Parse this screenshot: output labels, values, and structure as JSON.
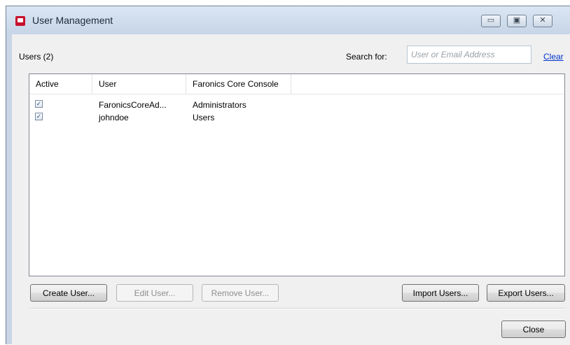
{
  "window": {
    "title": "User Management",
    "controls": {
      "minimize": "▭",
      "maximize": "▣",
      "close": "✕"
    }
  },
  "header": {
    "users_count": "Users (2)",
    "search_label": "Search for:",
    "search_placeholder": "User or Email Address",
    "search_value": "",
    "clear_label": "Clear"
  },
  "table": {
    "columns": [
      "Active",
      "User",
      "Faronics Core Console"
    ],
    "rows": [
      {
        "active": true,
        "user": "FaronicsCoreAd...",
        "console": "Administrators"
      },
      {
        "active": true,
        "user": "johndoe",
        "console": "Users"
      }
    ]
  },
  "buttons": {
    "create_user": "Create User...",
    "edit_user": "Edit User...",
    "remove_user": "Remove User...",
    "import_users": "Import Users...",
    "export_users": "Export Users...",
    "close": "Close"
  },
  "colors": {
    "window_frame": "#c9d6e6",
    "link": "#0033cc",
    "app_icon": "#c8102e"
  }
}
